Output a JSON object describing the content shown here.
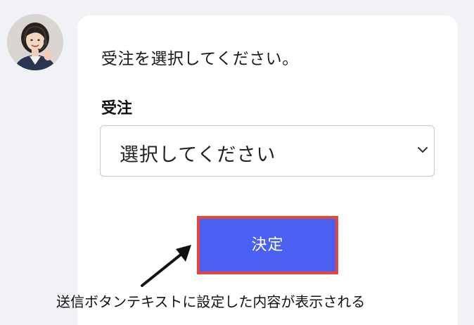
{
  "chat": {
    "avatar_icon": "operator-avatar-icon",
    "prompt_text": "受注を選択してください。",
    "field_label": "受注",
    "select": {
      "selected_value": "選択してください",
      "chevron_icon": "chevron-down-icon"
    },
    "submit_label": "決定"
  },
  "annotation": {
    "text": "送信ボタンテキストに設定した内容が表示される",
    "arrow_icon": "arrow-up-right-icon",
    "highlight_color": "#e8443a"
  },
  "colors": {
    "button": "#4a60f0",
    "page_background": "#f1f2f5",
    "card_background": "#ffffff"
  }
}
